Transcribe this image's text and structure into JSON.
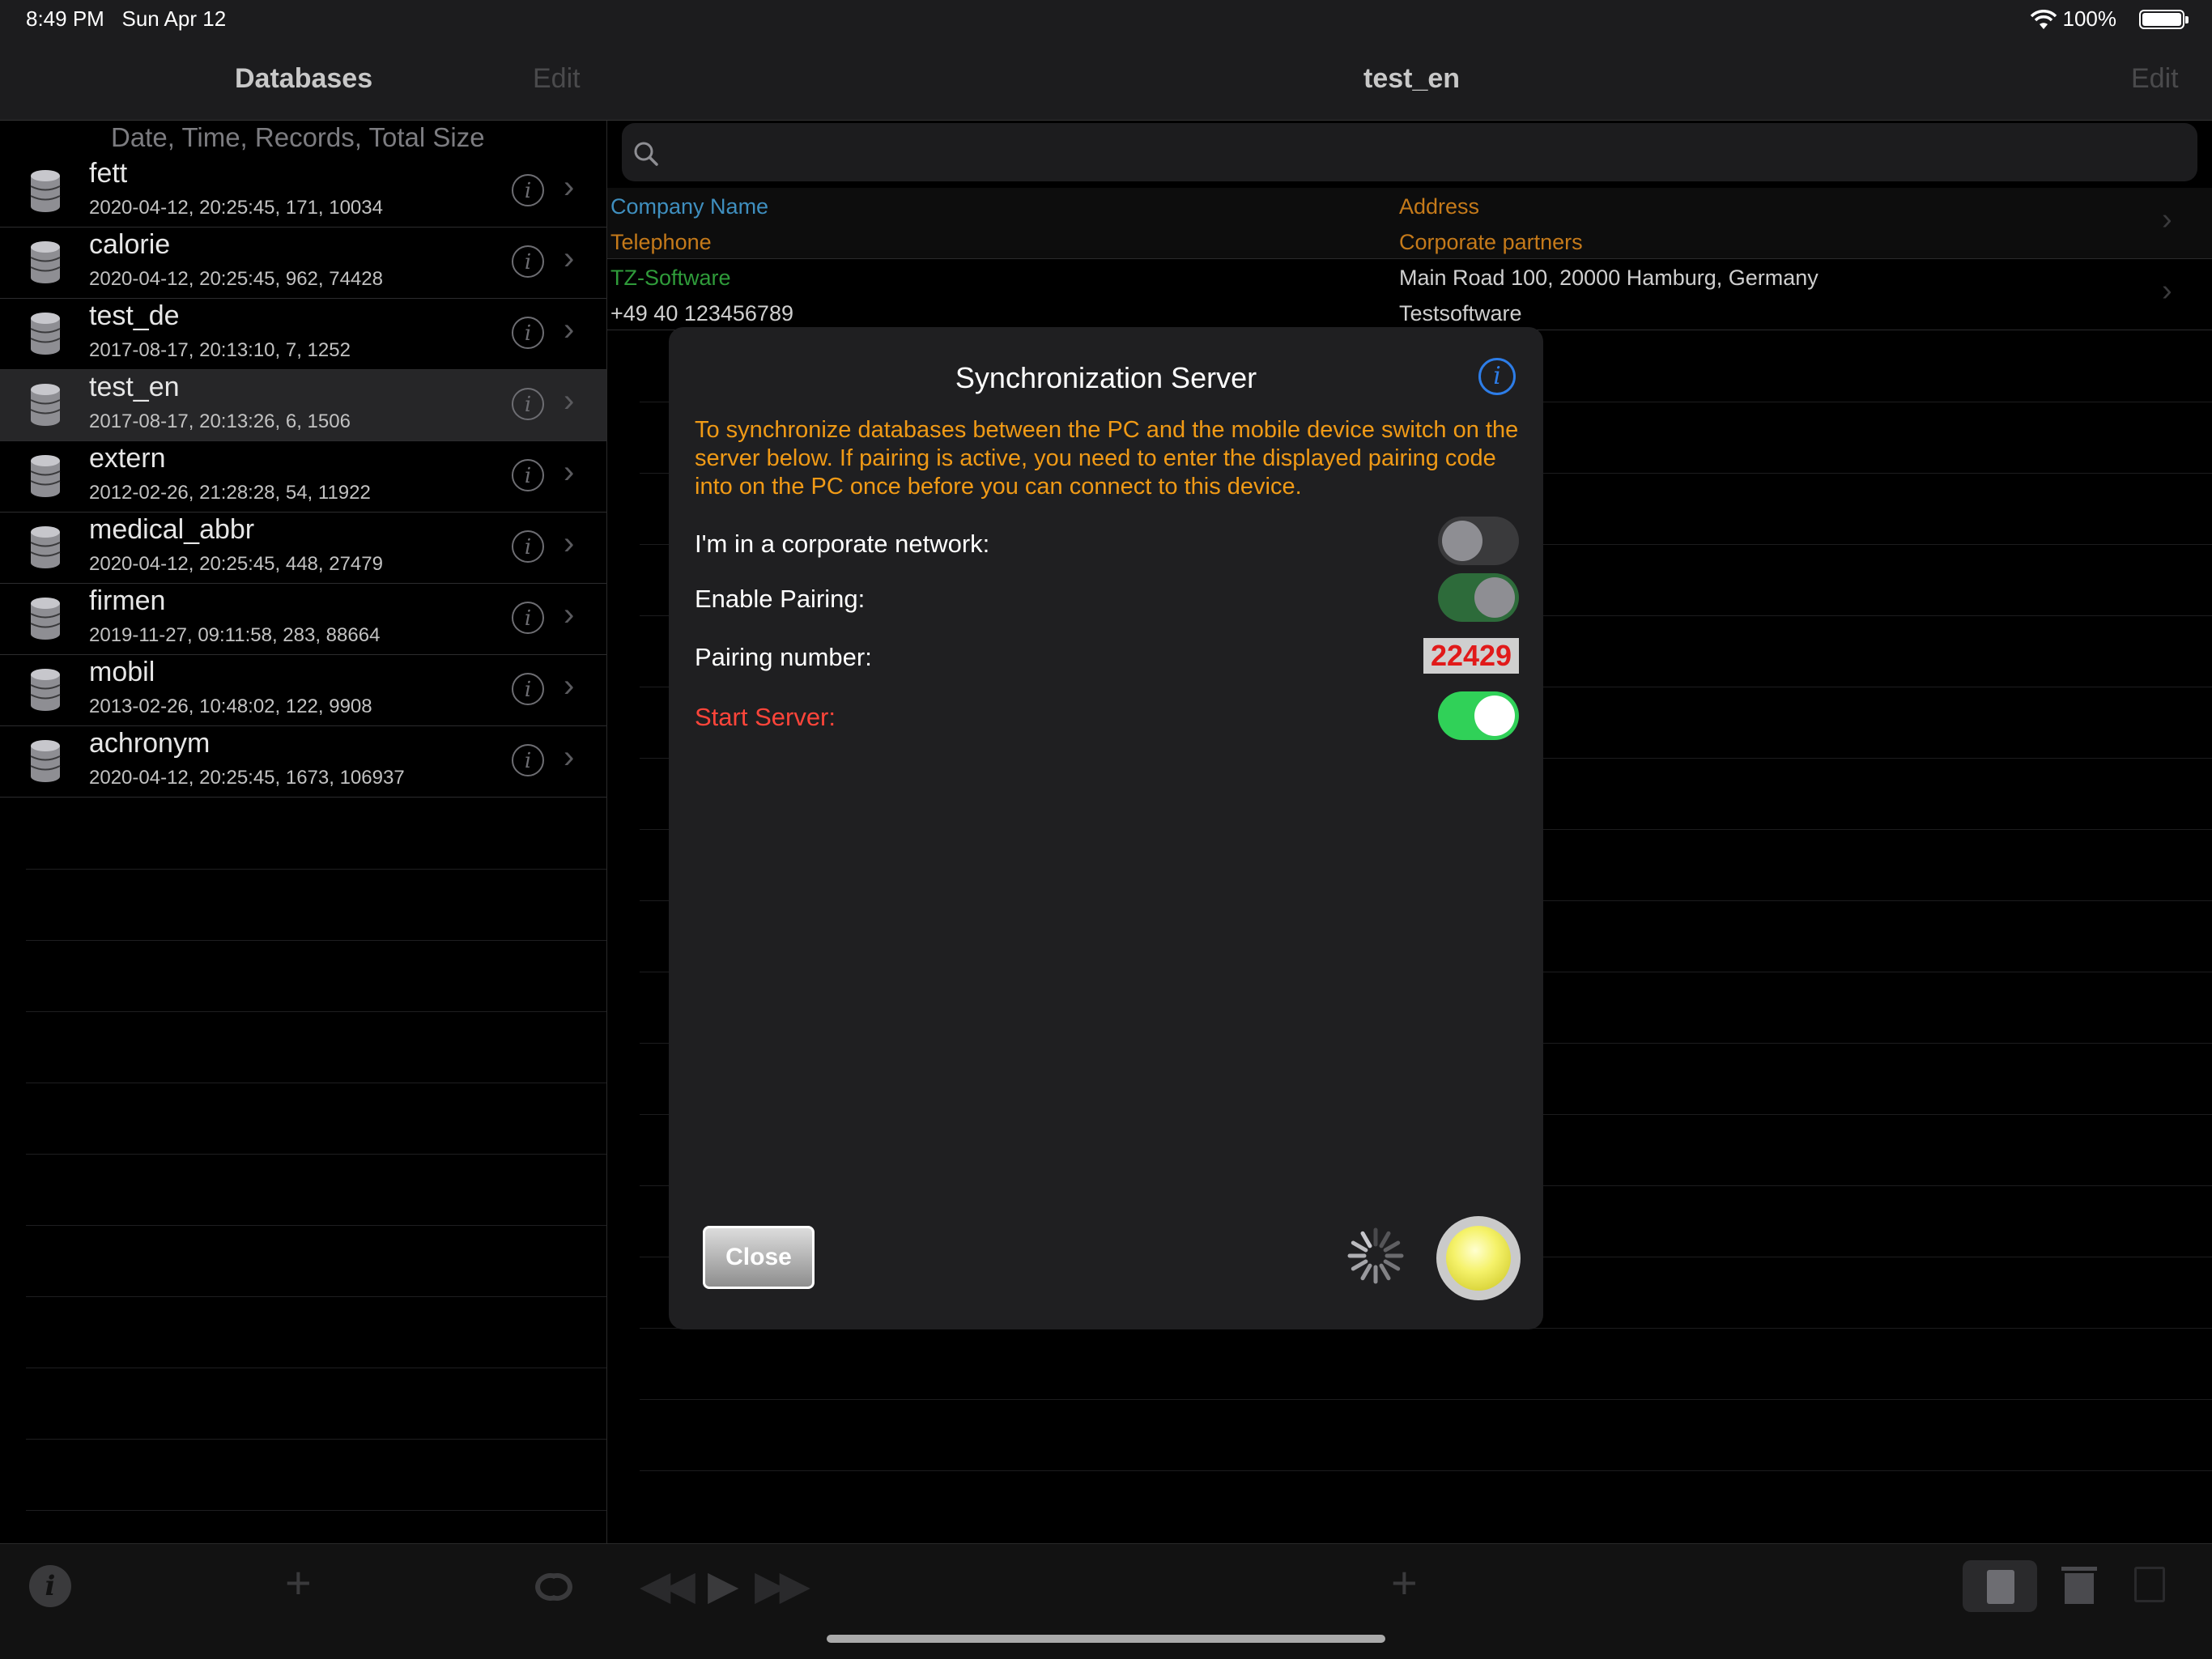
{
  "status_bar": {
    "time": "8:49 PM",
    "date": "Sun Apr 12",
    "battery": "100%"
  },
  "left_nav": {
    "title": "Databases",
    "edit": "Edit"
  },
  "right_nav": {
    "title": "test_en",
    "edit": "Edit"
  },
  "sidebar": {
    "header": "Date, Time, Records, Total Size",
    "selected": "test_en",
    "items": [
      {
        "name": "fett",
        "meta": "2020-04-12, 20:25:45, 171, 10034"
      },
      {
        "name": "calorie",
        "meta": "2020-04-12, 20:25:45, 962, 74428"
      },
      {
        "name": "test_de",
        "meta": "2017-08-17, 20:13:10, 7, 1252"
      },
      {
        "name": "test_en",
        "meta": "2017-08-17, 20:13:26, 6, 1506"
      },
      {
        "name": "extern",
        "meta": "2012-02-26, 21:28:28, 54, 11922"
      },
      {
        "name": "medical_abbr",
        "meta": "2020-04-12, 20:25:45, 448, 27479"
      },
      {
        "name": "firmen",
        "meta": "2019-11-27, 09:11:58, 283, 88664"
      },
      {
        "name": "mobil",
        "meta": "2013-02-26, 10:48:02, 122, 9908"
      },
      {
        "name": "achronym",
        "meta": "2020-04-12, 20:25:45, 1673, 106937"
      }
    ]
  },
  "records": {
    "header": {
      "c1": "Company Name",
      "c2": "Address",
      "c3": "Telephone",
      "c4": "Corporate partners"
    },
    "row": {
      "c1": "TZ-Software",
      "c2": "Main Road 100, 20000 Hamburg, Germany",
      "c3": "+49 40 123456789",
      "c4": "Testsoftware"
    }
  },
  "modal": {
    "title": "Synchronization Server",
    "description": "To synchronize databases between the PC and the mobile device switch on the server below. If pairing is active, you need to enter the displayed pairing code into on the PC once before you can connect to this device.",
    "corporate_label": "I'm in a corporate network:",
    "corporate_on": false,
    "pairing_label": "Enable Pairing:",
    "pairing_on": true,
    "pairing_number_label": "Pairing number:",
    "pairing_number": "22429",
    "server_label": "Start Server:",
    "server_on": true,
    "close_label": "Close"
  },
  "colors": {
    "accent_orange": "#f09a16",
    "header_blue": "#3f8fbf",
    "header_orange": "#c57a1a",
    "company_green": "#2f9b3a",
    "toggle_green": "#30d158",
    "server_red": "#ff453a"
  },
  "icons": {
    "database": "database-icon",
    "info": "info-icon",
    "chevron": "chevron-right-icon",
    "search": "search-icon",
    "sync": "sync-icon",
    "add": "plus-icon",
    "trash": "trash-icon",
    "document": "document-icon"
  }
}
